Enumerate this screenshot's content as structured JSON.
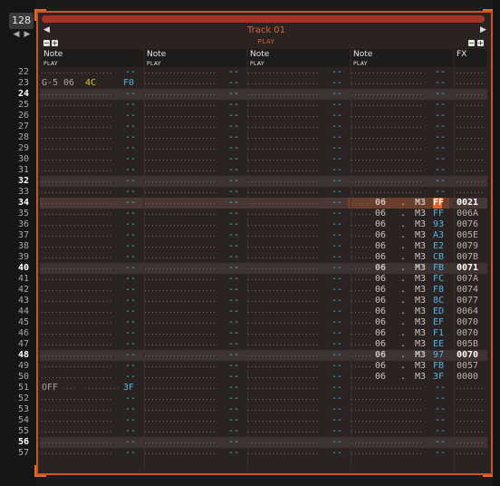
{
  "lines_per_beat": "128",
  "track": {
    "title": "Track 01",
    "mode": "PLAY"
  },
  "columns": [
    {
      "title": "Note",
      "mode": "PLAY"
    },
    {
      "title": "Note",
      "mode": "PLAY"
    },
    {
      "title": "Note",
      "mode": "PLAY"
    },
    {
      "title": "Note",
      "mode": "PLAY"
    },
    {
      "title": "FX",
      "mode": ""
    }
  ],
  "colors": {
    "accent": "#c95524",
    "instrument": "#e0c233",
    "hex_value": "#4fb6e6",
    "panel_bg": "#2b2322",
    "beat_row": "#3d3332"
  },
  "rows": [
    {
      "n": "22"
    },
    {
      "n": "23",
      "c1": {
        "note": "G-5",
        "inst": "06",
        "vol": "4C",
        "fxv": "F0"
      }
    },
    {
      "n": "24",
      "beat": true
    },
    {
      "n": "25"
    },
    {
      "n": "26"
    },
    {
      "n": "27"
    },
    {
      "n": "28"
    },
    {
      "n": "29"
    },
    {
      "n": "30"
    },
    {
      "n": "31"
    },
    {
      "n": "32",
      "beat": true
    },
    {
      "n": "33"
    },
    {
      "n": "34",
      "sel": true,
      "c4": {
        "inst": "06",
        "dot": ".",
        "vol": "M3",
        "fxv": "FF"
      },
      "fx": "0021"
    },
    {
      "n": "35",
      "c4": {
        "inst": "06",
        "dot": ".",
        "vol": "M3",
        "fxv": "FF"
      },
      "fx": "006A"
    },
    {
      "n": "36",
      "c4": {
        "inst": "06",
        "dot": ".",
        "vol": "M3",
        "fxv": "93"
      },
      "fx": "0076"
    },
    {
      "n": "37",
      "c4": {
        "inst": "06",
        "dot": ".",
        "vol": "M3",
        "fxv": "A3"
      },
      "fx": "005E"
    },
    {
      "n": "38",
      "c4": {
        "inst": "06",
        "dot": ".",
        "vol": "M3",
        "fxv": "E2"
      },
      "fx": "0079"
    },
    {
      "n": "39",
      "c4": {
        "inst": "06",
        "dot": ".",
        "vol": "M3",
        "fxv": "CB"
      },
      "fx": "007B"
    },
    {
      "n": "40",
      "beat": true,
      "c4": {
        "inst": "06",
        "dot": ".",
        "vol": "M3",
        "fxv": "FB"
      },
      "fx": "0071"
    },
    {
      "n": "41",
      "c4": {
        "inst": "06",
        "dot": ".",
        "vol": "M3",
        "fxv": "FC"
      },
      "fx": "007A"
    },
    {
      "n": "42",
      "c4": {
        "inst": "06",
        "dot": ".",
        "vol": "M3",
        "fxv": "F8"
      },
      "fx": "0074"
    },
    {
      "n": "43",
      "c4": {
        "inst": "06",
        "dot": ".",
        "vol": "M3",
        "fxv": "8C"
      },
      "fx": "0077"
    },
    {
      "n": "44",
      "c4": {
        "inst": "06",
        "dot": ".",
        "vol": "M3",
        "fxv": "ED"
      },
      "fx": "0064"
    },
    {
      "n": "45",
      "c4": {
        "inst": "06",
        "dot": ".",
        "vol": "M3",
        "fxv": "EF"
      },
      "fx": "0070"
    },
    {
      "n": "46",
      "c4": {
        "inst": "06",
        "dot": ".",
        "vol": "M3",
        "fxv": "F1"
      },
      "fx": "0070"
    },
    {
      "n": "47",
      "c4": {
        "inst": "06",
        "dot": ".",
        "vol": "M3",
        "fxv": "EE"
      },
      "fx": "005B"
    },
    {
      "n": "48",
      "beat": true,
      "c4": {
        "inst": "06",
        "dot": ".",
        "vol": "M3",
        "fxv": "97"
      },
      "fx": "0070"
    },
    {
      "n": "49",
      "c4": {
        "inst": "06",
        "dot": ".",
        "vol": "M3",
        "fxv": "FB"
      },
      "fx": "0057"
    },
    {
      "n": "50",
      "c4": {
        "inst": "06",
        "dot": ".",
        "vol": "M3",
        "fxv": "3F"
      },
      "fx": "0000"
    },
    {
      "n": "51",
      "c1": {
        "note": "OFF",
        "fxv": "3F"
      }
    },
    {
      "n": "52"
    },
    {
      "n": "53"
    },
    {
      "n": "54"
    },
    {
      "n": "55"
    },
    {
      "n": "56",
      "beat": true
    },
    {
      "n": "57"
    }
  ]
}
